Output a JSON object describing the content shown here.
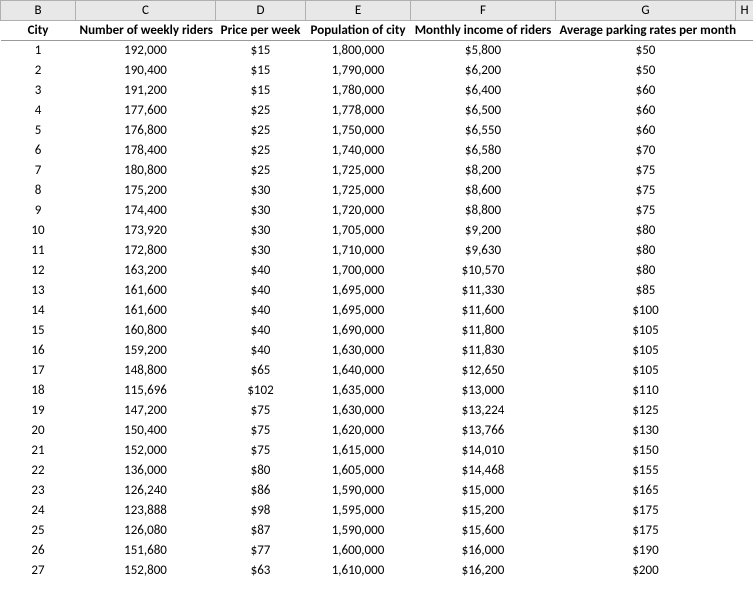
{
  "columns": [
    "B",
    "C",
    "D",
    "E",
    "F",
    "G",
    "H"
  ],
  "headers": {
    "city": "City",
    "riders": "Number of weekly riders",
    "price": "Price per week",
    "population": "Population of city",
    "income": "Monthly income of riders",
    "parking": "Average parking rates per month"
  },
  "rows": [
    {
      "city": "1",
      "riders": "192,000",
      "price": "$15",
      "population": "1,800,000",
      "income": "$5,800",
      "parking": "$50"
    },
    {
      "city": "2",
      "riders": "190,400",
      "price": "$15",
      "population": "1,790,000",
      "income": "$6,200",
      "parking": "$50"
    },
    {
      "city": "3",
      "riders": "191,200",
      "price": "$15",
      "population": "1,780,000",
      "income": "$6,400",
      "parking": "$60"
    },
    {
      "city": "4",
      "riders": "177,600",
      "price": "$25",
      "population": "1,778,000",
      "income": "$6,500",
      "parking": "$60"
    },
    {
      "city": "5",
      "riders": "176,800",
      "price": "$25",
      "population": "1,750,000",
      "income": "$6,550",
      "parking": "$60"
    },
    {
      "city": "6",
      "riders": "178,400",
      "price": "$25",
      "population": "1,740,000",
      "income": "$6,580",
      "parking": "$70"
    },
    {
      "city": "7",
      "riders": "180,800",
      "price": "$25",
      "population": "1,725,000",
      "income": "$8,200",
      "parking": "$75"
    },
    {
      "city": "8",
      "riders": "175,200",
      "price": "$30",
      "population": "1,725,000",
      "income": "$8,600",
      "parking": "$75"
    },
    {
      "city": "9",
      "riders": "174,400",
      "price": "$30",
      "population": "1,720,000",
      "income": "$8,800",
      "parking": "$75"
    },
    {
      "city": "10",
      "riders": "173,920",
      "price": "$30",
      "population": "1,705,000",
      "income": "$9,200",
      "parking": "$80"
    },
    {
      "city": "11",
      "riders": "172,800",
      "price": "$30",
      "population": "1,710,000",
      "income": "$9,630",
      "parking": "$80"
    },
    {
      "city": "12",
      "riders": "163,200",
      "price": "$40",
      "population": "1,700,000",
      "income": "$10,570",
      "parking": "$80"
    },
    {
      "city": "13",
      "riders": "161,600",
      "price": "$40",
      "population": "1,695,000",
      "income": "$11,330",
      "parking": "$85"
    },
    {
      "city": "14",
      "riders": "161,600",
      "price": "$40",
      "population": "1,695,000",
      "income": "$11,600",
      "parking": "$100"
    },
    {
      "city": "15",
      "riders": "160,800",
      "price": "$40",
      "population": "1,690,000",
      "income": "$11,800",
      "parking": "$105"
    },
    {
      "city": "16",
      "riders": "159,200",
      "price": "$40",
      "population": "1,630,000",
      "income": "$11,830",
      "parking": "$105"
    },
    {
      "city": "17",
      "riders": "148,800",
      "price": "$65",
      "population": "1,640,000",
      "income": "$12,650",
      "parking": "$105"
    },
    {
      "city": "18",
      "riders": "115,696",
      "price": "$102",
      "population": "1,635,000",
      "income": "$13,000",
      "parking": "$110"
    },
    {
      "city": "19",
      "riders": "147,200",
      "price": "$75",
      "population": "1,630,000",
      "income": "$13,224",
      "parking": "$125"
    },
    {
      "city": "20",
      "riders": "150,400",
      "price": "$75",
      "population": "1,620,000",
      "income": "$13,766",
      "parking": "$130"
    },
    {
      "city": "21",
      "riders": "152,000",
      "price": "$75",
      "population": "1,615,000",
      "income": "$14,010",
      "parking": "$150"
    },
    {
      "city": "22",
      "riders": "136,000",
      "price": "$80",
      "population": "1,605,000",
      "income": "$14,468",
      "parking": "$155"
    },
    {
      "city": "23",
      "riders": "126,240",
      "price": "$86",
      "population": "1,590,000",
      "income": "$15,000",
      "parking": "$165"
    },
    {
      "city": "24",
      "riders": "123,888",
      "price": "$98",
      "population": "1,595,000",
      "income": "$15,200",
      "parking": "$175"
    },
    {
      "city": "25",
      "riders": "126,080",
      "price": "$87",
      "population": "1,590,000",
      "income": "$15,600",
      "parking": "$175"
    },
    {
      "city": "26",
      "riders": "151,680",
      "price": "$77",
      "population": "1,600,000",
      "income": "$16,000",
      "parking": "$190"
    },
    {
      "city": "27",
      "riders": "152,800",
      "price": "$63",
      "population": "1,610,000",
      "income": "$16,200",
      "parking": "$200"
    }
  ]
}
